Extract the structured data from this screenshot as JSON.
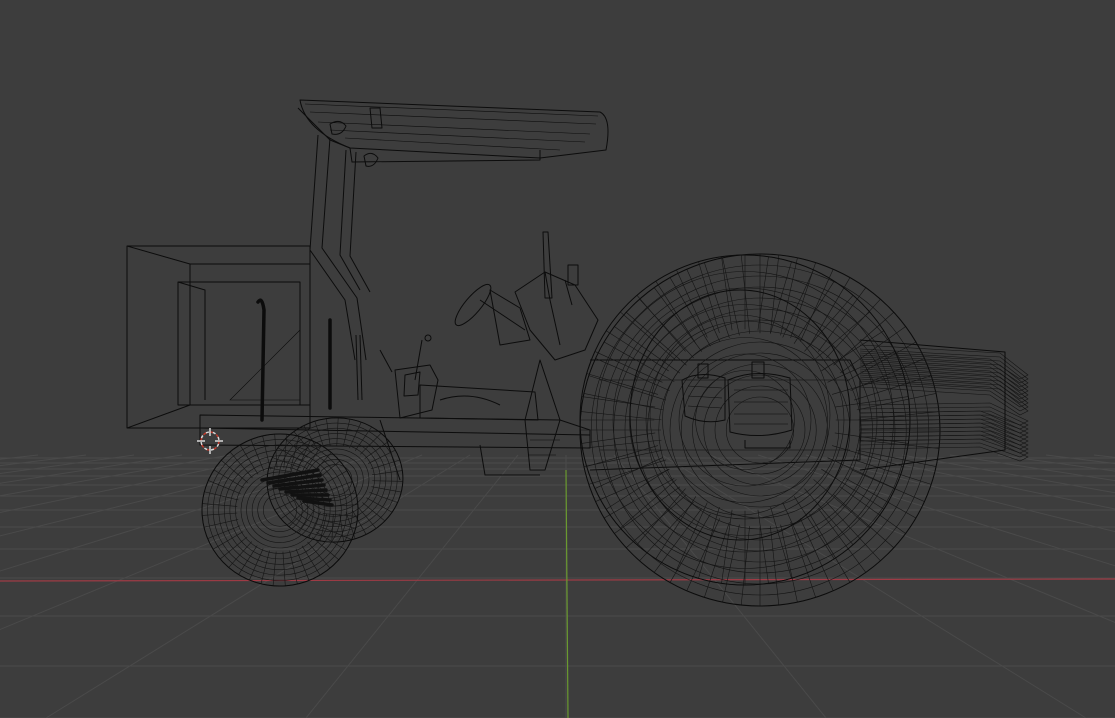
{
  "viewport": {
    "shading_mode": "wireframe",
    "background_color": "#3d3d3d",
    "grid_color": "#4a4a4a",
    "axis_x_color": "#9e3b45",
    "axis_y_color": "#6a9a2f",
    "wire_color": "#0c0c0c",
    "cursor_color": "#d8d8d8",
    "cursor_accent_color": "#c0392b"
  },
  "scene": {
    "object": "tractor",
    "icons": {
      "cursor": "3d-cursor-icon"
    }
  }
}
